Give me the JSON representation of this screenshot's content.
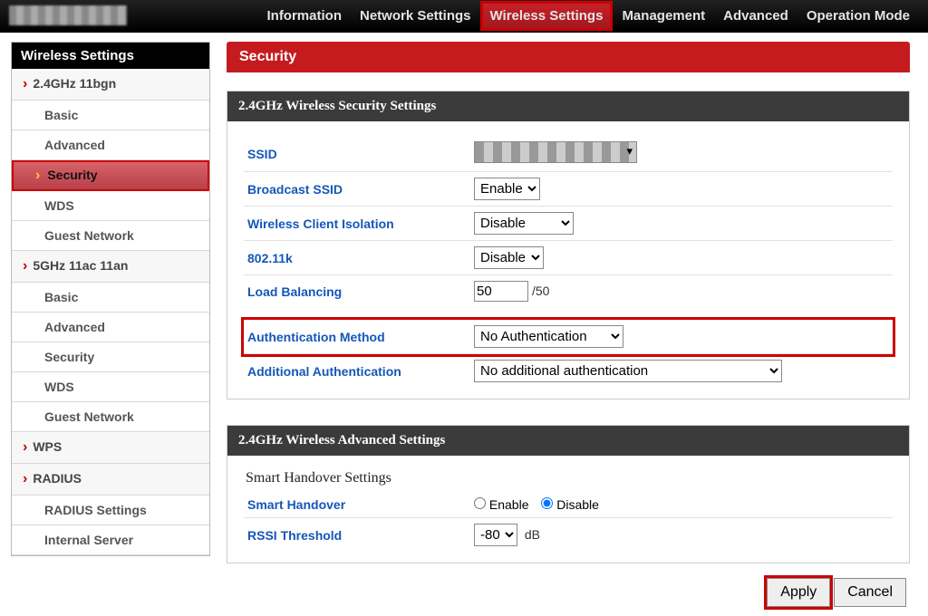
{
  "topnav": {
    "items": [
      "Information",
      "Network Settings",
      "Wireless Settings",
      "Management",
      "Advanced",
      "Operation Mode"
    ],
    "active_index": 2
  },
  "sidebar": {
    "title": "Wireless Settings",
    "groups": [
      {
        "label": "2.4GHz 11bgn",
        "items": [
          "Basic",
          "Advanced",
          "Security",
          "WDS",
          "Guest Network"
        ],
        "selected_item_index": 2
      },
      {
        "label": "5GHz 11ac 11an",
        "items": [
          "Basic",
          "Advanced",
          "Security",
          "WDS",
          "Guest Network"
        ]
      },
      {
        "label": "WPS",
        "items": []
      },
      {
        "label": "RADIUS",
        "items": [
          "RADIUS Settings",
          "Internal Server"
        ]
      }
    ]
  },
  "page": {
    "title": "Security"
  },
  "sec_panel": {
    "header": "2.4GHz Wireless Security Settings",
    "ssid_label": "SSID",
    "broadcast_label": "Broadcast SSID",
    "broadcast_value": "Enable",
    "iso_label": "Wireless Client Isolation",
    "iso_value": "Disable",
    "k_label": "802.11k",
    "k_value": "Disable",
    "lb_label": "Load Balancing",
    "lb_value": "50",
    "lb_hint": "/50",
    "auth_label": "Authentication Method",
    "auth_value": "No Authentication",
    "addauth_label": "Additional Authentication",
    "addauth_value": "No additional authentication"
  },
  "adv_panel": {
    "header": "2.4GHz Wireless Advanced Settings",
    "sub_heading": "Smart Handover Settings",
    "handover_label": "Smart Handover",
    "enable_text": "Enable",
    "disable_text": "Disable",
    "rssi_label": "RSSI Threshold",
    "rssi_value": "-80",
    "rssi_unit": "dB"
  },
  "buttons": {
    "apply": "Apply",
    "cancel": "Cancel"
  }
}
